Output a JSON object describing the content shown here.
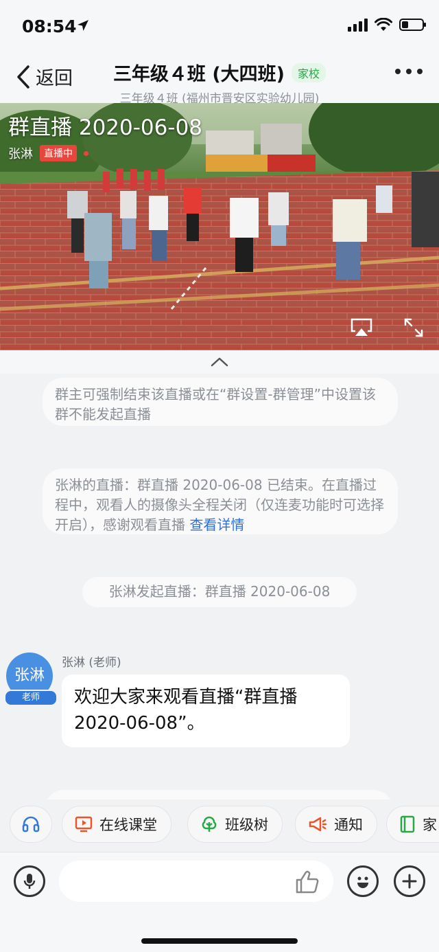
{
  "status_bar": {
    "time": "08:54",
    "battery_level": 0.3
  },
  "header": {
    "back_label": "返回",
    "title": "三年级４班 (大四班)",
    "badge": "家校",
    "subtitle": "三年级４班 (福州市晋安区实验幼儿园)"
  },
  "video": {
    "title": "群直播 2020-06-08",
    "host": "张淋",
    "live_label": "直播中"
  },
  "chat": {
    "sys_msg_1": "群主可强制结束该直播或在“群设置-群管理”中设置该群不能发起直播",
    "sys_msg_2": "张淋的直播：群直播 2020-06-08 已结束。在直播过程中，观看人的摄像头全程关闭（仅连麦功能时可选择开启），感谢观看直播",
    "sys_msg_2_link": "查看详情",
    "sys_msg_3": "张淋发起直播：群直播 2020-06-08",
    "message": {
      "avatar_text": "张淋",
      "avatar_tag": "老师",
      "sender": "张淋 (老师)",
      "text": "欢迎大家来观看直播“群直播 2020-06-08”。"
    }
  },
  "quick_actions": [
    {
      "label": "",
      "icon": "headset-icon"
    },
    {
      "label": "在线课堂",
      "icon": "play-screen-icon"
    },
    {
      "label": "班级树",
      "icon": "tree-icon"
    },
    {
      "label": "通知",
      "icon": "megaphone-icon"
    },
    {
      "label": "家",
      "icon": "book-icon"
    }
  ],
  "input_bar": {
    "placeholder": ""
  },
  "colors": {
    "accent": "#2f6fe0",
    "live": "#e8453c",
    "badge_green": "#27a844"
  }
}
